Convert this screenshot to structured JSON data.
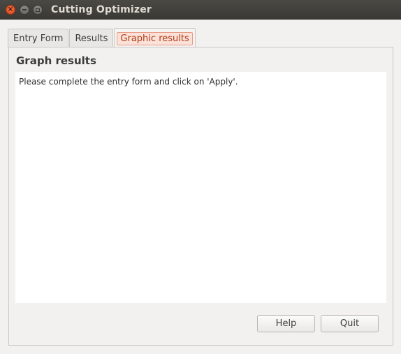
{
  "window": {
    "title": "Cutting Optimizer",
    "close_glyph": "×"
  },
  "tabs": [
    {
      "label": "Entry Form",
      "active": false
    },
    {
      "label": "Results",
      "active": false
    },
    {
      "label": "Graphic results",
      "active": true
    }
  ],
  "panel": {
    "title": "Graph results",
    "message": "Please complete the entry form and click on 'Apply'."
  },
  "buttons": {
    "help_label": "Help",
    "quit_label": "Quit"
  },
  "colors": {
    "titlebar": "#3c3b37",
    "close_button": "#e95420",
    "active_tab_highlight": "#fbe1d8"
  }
}
